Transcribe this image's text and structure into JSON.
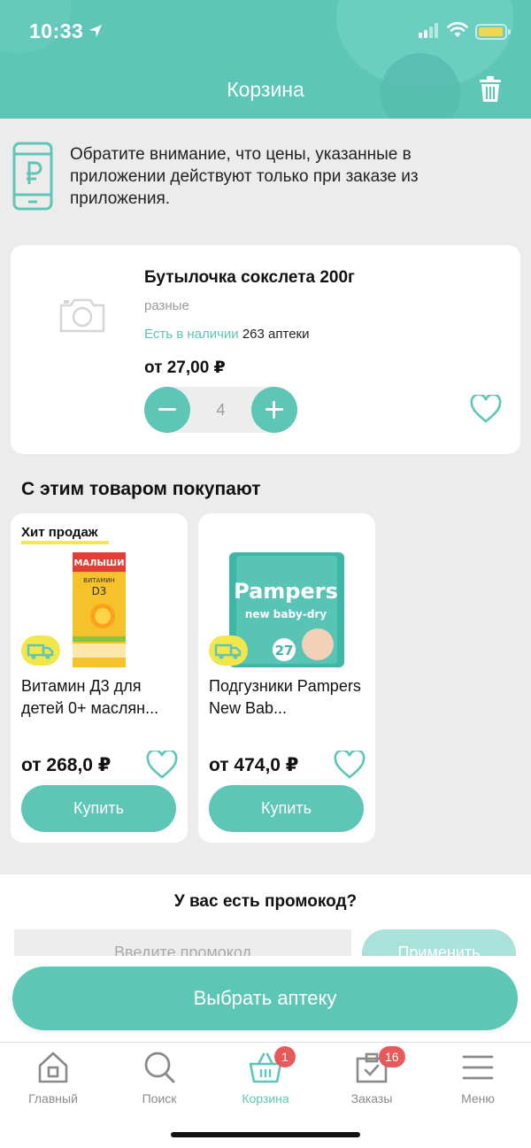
{
  "status_bar": {
    "time": "10:33"
  },
  "header": {
    "title": "Корзина"
  },
  "notice": {
    "text": "Обратите внимание, что цены, указанные в приложении действуют только при заказе из приложения."
  },
  "cart_item": {
    "name": "Бутылочка сокслета 200г",
    "brand": "разные",
    "availability_label": "Есть в наличии",
    "availability_count": "263 аптеки",
    "price": "от 27,00 ₽",
    "quantity": "4"
  },
  "recommendations": {
    "title": "С этим товаром покупают",
    "items": [
      {
        "badge": "Хит продаж",
        "name": "Витамин Д3 для детей 0+ маслян...",
        "price": "от 268,0 ₽",
        "buy_label": "Купить",
        "image_text": "ВИТАМИН D3"
      },
      {
        "badge": "",
        "name": "Подгузники Pampers New Bab...",
        "price": "от 474,0 ₽",
        "buy_label": "Купить",
        "image_text": "Pampers new baby-dry",
        "pack_count": "27"
      }
    ]
  },
  "promo": {
    "title": "У вас есть промокод?",
    "placeholder": "Введите промокод",
    "apply_label": "Применить"
  },
  "choose_pharmacy_label": "Выбрать аптеку",
  "tabbar": {
    "tabs": [
      {
        "label": "Главный",
        "icon": "home-icon",
        "active": false
      },
      {
        "label": "Поиск",
        "icon": "search-icon",
        "active": false
      },
      {
        "label": "Корзина",
        "icon": "basket-icon",
        "active": true,
        "badge": "1"
      },
      {
        "label": "Заказы",
        "icon": "orders-icon",
        "active": false,
        "badge": "16"
      },
      {
        "label": "Меню",
        "icon": "menu-icon",
        "active": false
      }
    ]
  },
  "colors": {
    "accent": "#5ec6b7",
    "badge": "#e8595b",
    "hit_underline": "#f5e94a"
  }
}
